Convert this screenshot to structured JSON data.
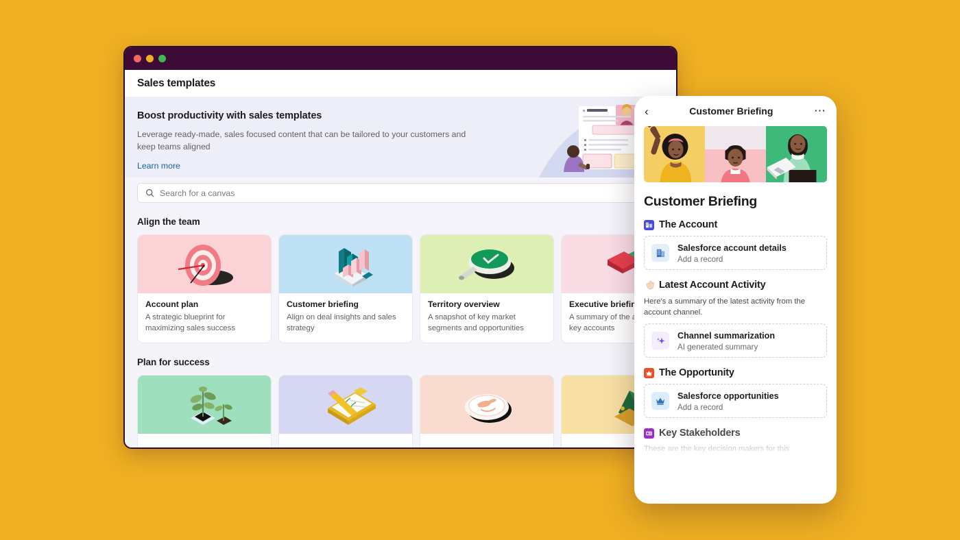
{
  "background_color": "#EFAF22",
  "window": {
    "titlebar_color": "#3D0B35",
    "traffic_lights": [
      "close-red",
      "minimize-yellow",
      "maximize-green"
    ],
    "header_title": "Sales templates",
    "hero": {
      "heading": "Boost productivity with sales templates",
      "body": "Leverage ready-made, sales focused content that can be tailored to your customers and keep teams aligned",
      "link_label": "Learn more",
      "link_color": "#1264A3",
      "art_name": "canvas-document-illustration",
      "background": "#EEEEF8"
    },
    "search": {
      "placeholder": "Search for a canvas",
      "icon": "search-icon"
    },
    "sections": [
      {
        "title": "Align the team",
        "cards": [
          {
            "title": "Account plan",
            "desc": "A strategic blueprint for maximizing sales success",
            "art": "dartboard-target-illustration",
            "art_bg": "#FBD3D6"
          },
          {
            "title": "Customer briefing",
            "desc": "Align on deal insights and sales strategy",
            "art": "bar-chart-briefcase-illustration",
            "art_bg": "#BEE0F5"
          },
          {
            "title": "Territory overview",
            "desc": "A snapshot of key market segments and opportunities",
            "art": "magnifying-glass-illustration",
            "art_bg": "#DDEFB4"
          },
          {
            "title": "Executive briefing",
            "desc": "A summary of the account and key accounts",
            "art": "puzzle-pieces-illustration",
            "art_bg": "#FADCE5"
          }
        ]
      },
      {
        "title": "Plan for success",
        "cards": [
          {
            "title": "",
            "desc": "",
            "art": "seedling-plant-illustration",
            "art_bg": "#9EE0BE"
          },
          {
            "title": "",
            "desc": "",
            "art": "clipboard-checklist-illustration",
            "art_bg": "#D6D7F2"
          },
          {
            "title": "",
            "desc": "",
            "art": "coffee-cup-illustration",
            "art_bg": "#F9DCCF"
          },
          {
            "title": "",
            "desc": "",
            "art": "growth-chart-illustration",
            "art_bg": "#F8DFA4"
          }
        ]
      }
    ]
  },
  "briefing_panel": {
    "back_icon": "chevron-left-icon",
    "header_title": "Customer Briefing",
    "more_icon": "ellipsis-icon",
    "banner": {
      "name": "people-collage-illustration",
      "cells": [
        {
          "bg": "#F5CE63",
          "figure": "person-waving"
        },
        {
          "bg": "#F8BFC4",
          "figure": "person-portrait"
        },
        {
          "bg": "#3EB97A",
          "figure": "person-holding-laptop"
        }
      ]
    },
    "doc_title": "Customer Briefing",
    "sections": [
      {
        "icon": "account-building-icon",
        "icon_bg": "#4A4AE0",
        "label": "The Account",
        "note": "",
        "records": [
          {
            "icon": "salesforce-building-icon",
            "icon_bg": "#E3EEFA",
            "icon_color": "#3C78C8",
            "title": "Salesforce account details",
            "sub": "Add a record"
          }
        ]
      },
      {
        "icon": "waving-hand-icon",
        "icon_bg": "transparent",
        "label": "Latest Account Activity",
        "note": "Here's a summary of the latest activity from the account channel.",
        "records": [
          {
            "icon": "sparkle-ai-icon",
            "icon_bg": "#F4EDFB",
            "icon_color": "#6B4FD8",
            "title": "Channel summarization",
            "sub": "AI generated summary"
          }
        ]
      },
      {
        "icon": "crown-icon",
        "icon_bg": "#EC4E28",
        "label": "The Opportunity",
        "note": "",
        "records": [
          {
            "icon": "crown-icon",
            "icon_bg": "#DCEDF9",
            "icon_color": "#2E72B8",
            "title": "Salesforce opportunities",
            "sub": "Add a record"
          }
        ]
      },
      {
        "icon": "id-card-icon",
        "icon_bg": "#9B30C9",
        "label": "Key Stakeholders",
        "note": "These are the key decision makers for this",
        "records": []
      }
    ]
  }
}
